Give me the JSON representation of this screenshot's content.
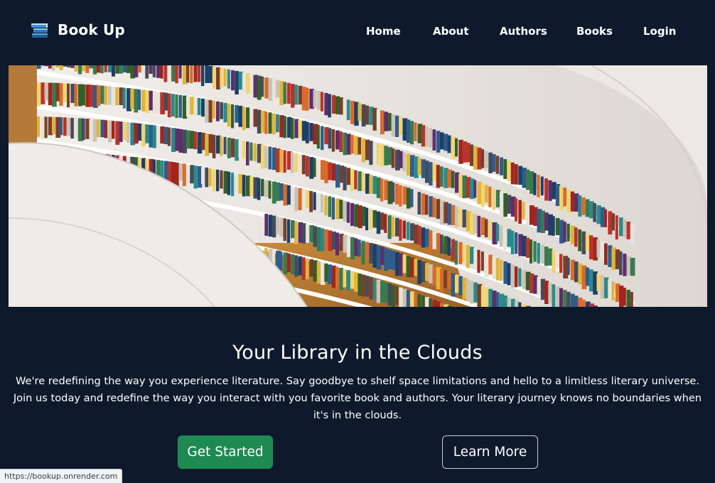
{
  "brand": {
    "name": "Book Up",
    "icon": "stacked-books-icon"
  },
  "nav": {
    "items": [
      {
        "label": "Home"
      },
      {
        "label": "About"
      },
      {
        "label": "Authors"
      },
      {
        "label": "Books"
      },
      {
        "label": "Login"
      }
    ]
  },
  "hero": {
    "image": "library-bookshelves-photo",
    "title": "Your Library in the Clouds",
    "text": "We're redefining the way you experience literature. Say goodbye to shelf space limitations and hello to a limitless literary universe. Join us today and redefine the way you interact with you favorite book and authors. Your literary journey knows no boundaries when it's in the clouds.",
    "primary_button": "Get Started",
    "secondary_button": "Learn More"
  },
  "status_bar": {
    "url": "https://bookup.onrender.com"
  },
  "colors": {
    "background": "#0e1a2b",
    "primary_button": "#1e8a52",
    "text": "#ffffff"
  }
}
